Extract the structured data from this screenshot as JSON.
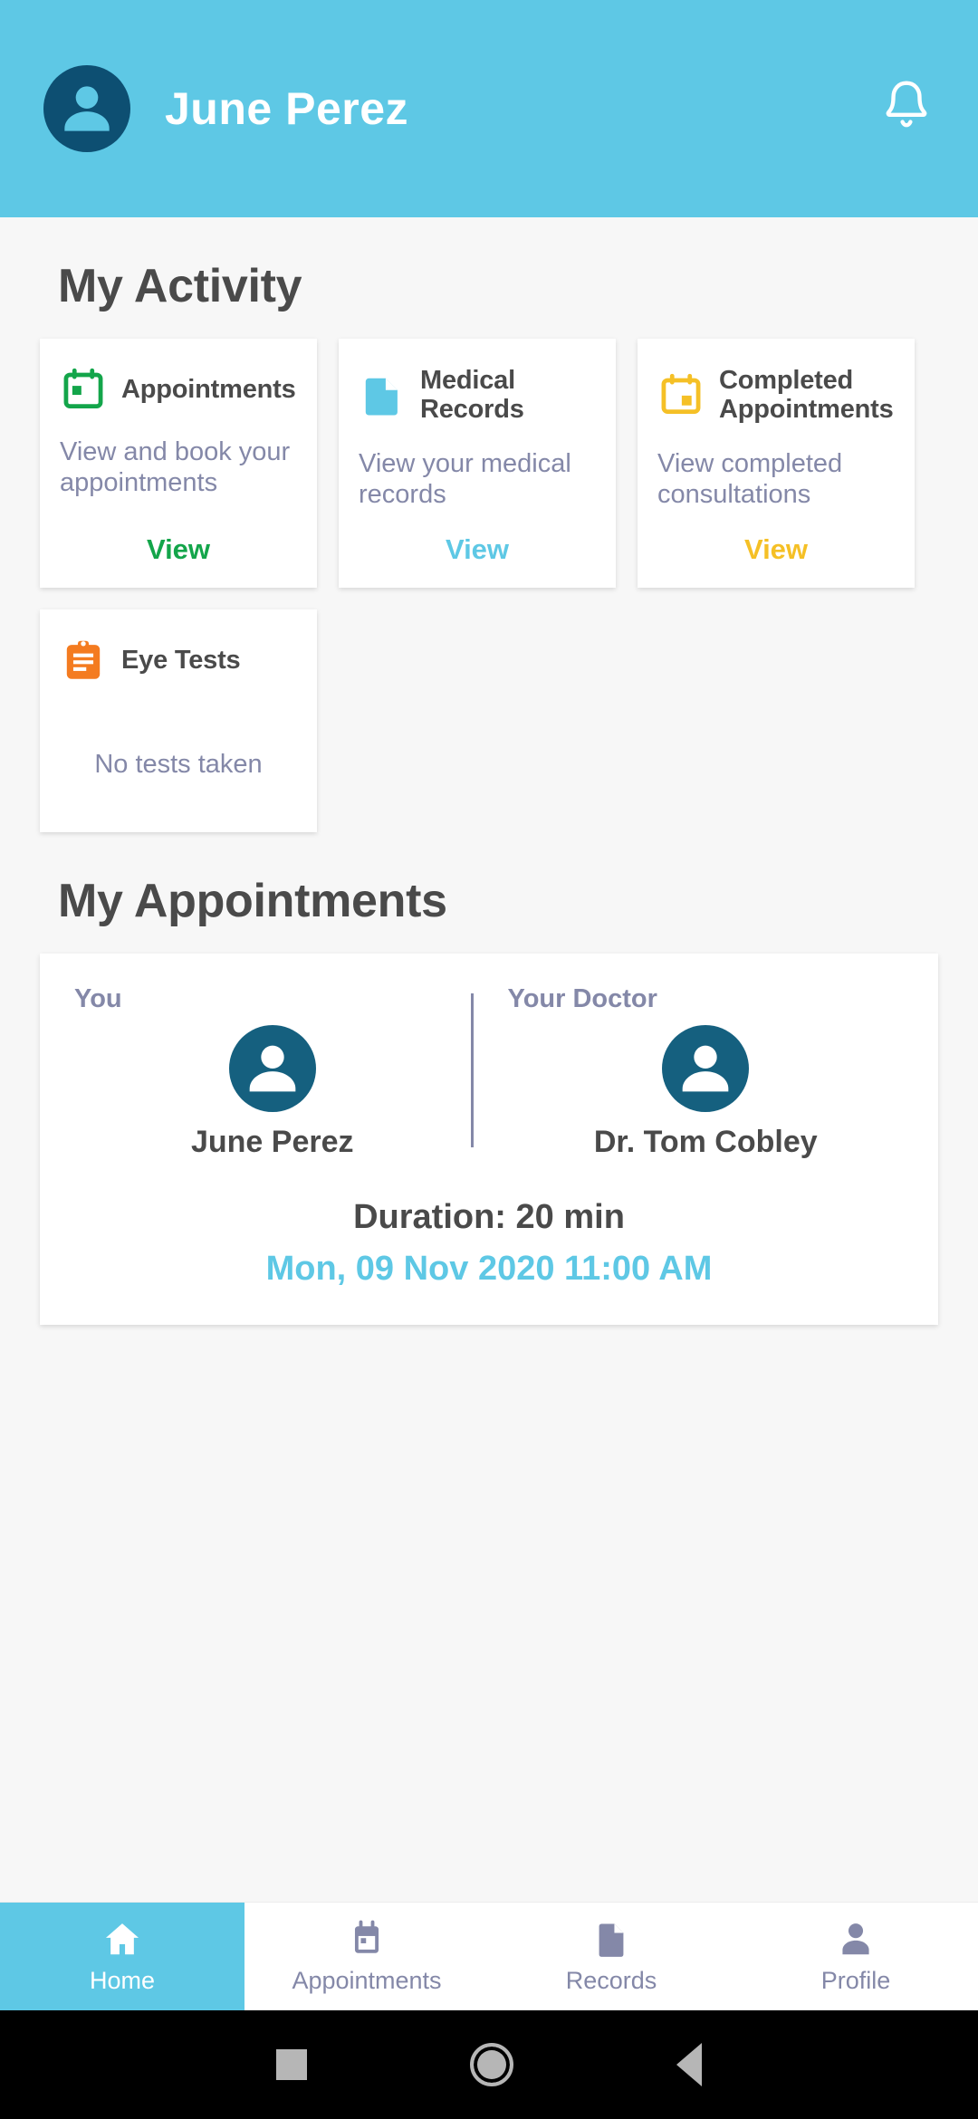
{
  "header": {
    "user_name": "June Perez",
    "avatar_icon": "person-avatar-icon",
    "notification_icon": "bell-icon",
    "background_color": "#5ec8e5"
  },
  "activity": {
    "section_title": "My Activity",
    "cards": [
      {
        "icon": "calendar-icon",
        "icon_color": "#13a54a",
        "title": "Appointments",
        "description": "View and book your appointments",
        "link_label": "View",
        "link_color": "#13a54a"
      },
      {
        "icon": "document-icon",
        "icon_color": "#5ec8e5",
        "title": "Medical Records",
        "description": "View your medical records",
        "link_label": "View",
        "link_color": "#5ec8e5"
      },
      {
        "icon": "calendar-check-icon",
        "icon_color": "#f5c026",
        "title": "Completed Appointments",
        "description": "View completed consultations",
        "link_label": "View",
        "link_color": "#f5c026"
      },
      {
        "icon": "clipboard-icon",
        "icon_color": "#f47b20",
        "title": "Eye Tests",
        "empty_text": "No tests taken"
      }
    ]
  },
  "appointments": {
    "section_title": "My Appointments",
    "card": {
      "you_label": "You",
      "doctor_label": "Your Doctor",
      "you_name": "June Perez",
      "doctor_name": "Dr. Tom Cobley",
      "duration": "Duration: 20 min",
      "datetime": "Mon, 09 Nov 2020  11:00 AM",
      "datetime_color": "#5ec8e5",
      "avatar_icon": "person-avatar-icon"
    }
  },
  "bottom_nav": {
    "items": [
      {
        "label": "Home",
        "icon": "home-icon",
        "active": true
      },
      {
        "label": "Appointments",
        "icon": "calendar-icon",
        "active": false
      },
      {
        "label": "Records",
        "icon": "document-icon",
        "active": false
      },
      {
        "label": "Profile",
        "icon": "person-icon",
        "active": false
      }
    ]
  },
  "system_nav": {
    "recents_icon": "square-recents-icon",
    "home_icon": "circle-home-icon",
    "back_icon": "triangle-back-icon"
  }
}
